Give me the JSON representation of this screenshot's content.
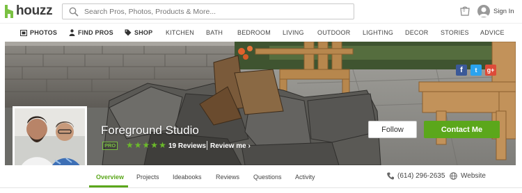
{
  "header": {
    "logo_text": "houzz",
    "search_placeholder": "Search Pros, Photos, Products & More...",
    "cart_count": "0",
    "signin_label": "Sign In"
  },
  "nav": {
    "items": [
      "PHOTOS",
      "FIND PROS",
      "SHOP",
      "KITCHEN",
      "BATH",
      "BEDROOM",
      "LIVING",
      "OUTDOOR",
      "LIGHTING",
      "DECOR",
      "STORIES",
      "ADVICE"
    ]
  },
  "profile": {
    "name": "Foreground Studio",
    "badge": "PRO",
    "rating": 5,
    "reviews_label": "19 Reviews",
    "review_me_label": "Review me",
    "follow_label": "Follow",
    "contact_label": "Contact Me",
    "social": [
      "f",
      "t",
      "g+"
    ]
  },
  "tabs": {
    "items": [
      "Overview",
      "Projects",
      "Ideabooks",
      "Reviews",
      "Questions",
      "Activity"
    ],
    "active": "Overview",
    "phone": "(614) 296-2635",
    "website_label": "Website"
  },
  "colors": {
    "accent_green": "#5ba71b",
    "facebook": "#3b5998",
    "twitter": "#2aa3ef",
    "google": "#dd4b39"
  }
}
